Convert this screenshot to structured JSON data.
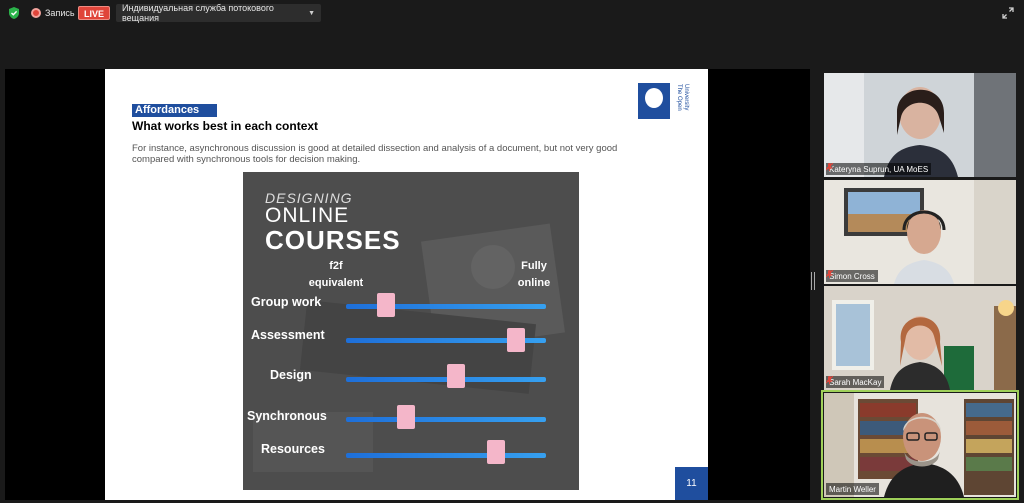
{
  "toolbar": {
    "recording_label": "Запись",
    "live_badge": "LIVE",
    "stream_service": "Индивидуальная служба потокового вещания"
  },
  "icons": {
    "security": "shield-check-icon",
    "recording": "record-dot-icon",
    "dropdown": "chevron-down-icon",
    "fullscreen": "expand-icon",
    "muted": "mic-muted-icon"
  },
  "slide": {
    "title": "Affordances",
    "subtitle": "What works best in each context",
    "body": "For instance, asynchronous discussion is good at detailed dissection and analysis of a document, but not very good compared with synchronous tools for decision making.",
    "logo_text_1": "The Open",
    "logo_text_2": "University",
    "page_number": "11",
    "infographic": {
      "heading_line1": "DESIGNING",
      "heading_line2": "ONLINE",
      "heading_line3": "COURSES",
      "left_label_1": "f2f",
      "left_label_2": "equivalent",
      "right_label_1": "Fully",
      "right_label_2": "online",
      "rows": [
        {
          "label": "Group work",
          "level": 0.2
        },
        {
          "label": "Assessment",
          "level": 0.85
        },
        {
          "label": "Design",
          "level": 0.55
        },
        {
          "label": "Synchronous",
          "level": 0.3
        },
        {
          "label": "Resources",
          "level": 0.75
        }
      ]
    }
  },
  "participants": [
    {
      "name": "Kateryna Suprun, UA MoES",
      "muted": true,
      "active": false
    },
    {
      "name": "Simon Cross",
      "muted": true,
      "active": false
    },
    {
      "name": "Sarah MacKay",
      "muted": true,
      "active": false
    },
    {
      "name": "Martin Weller",
      "muted": false,
      "active": true
    }
  ],
  "colors": {
    "ou_blue": "#1f4e9e",
    "live_red": "#e0453a",
    "speaker_outline": "#9fd05a",
    "slider_handle": "#f4b6c9",
    "slider_track": "#2a8ae6"
  }
}
